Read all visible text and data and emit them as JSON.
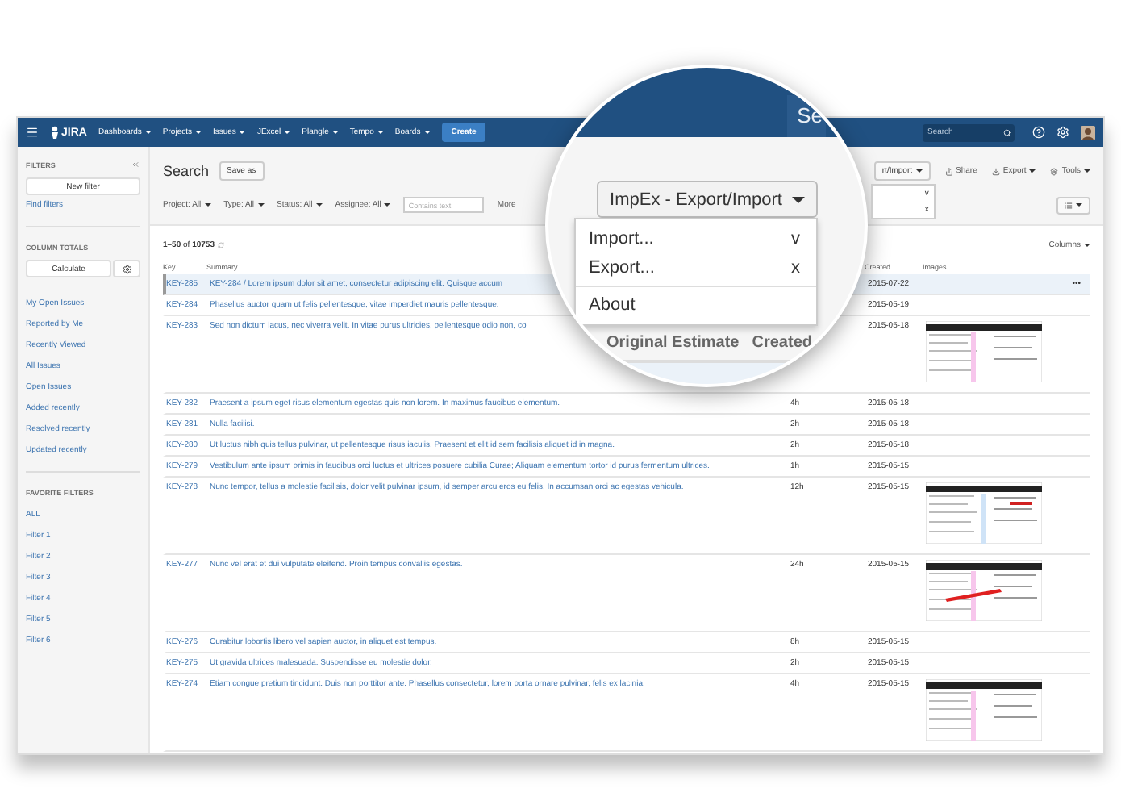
{
  "nav": {
    "logo": "JIRA",
    "items": [
      "Dashboards",
      "Projects",
      "Issues",
      "JExcel",
      "Plangle",
      "Tempo",
      "Boards"
    ],
    "create": "Create",
    "search": {
      "placeholder": "Search"
    }
  },
  "sidebar": {
    "filters_title": "FILTERS",
    "new_filter": "New filter",
    "find_filters": "Find filters",
    "totals_title": "COLUMN TOTALS",
    "calculate": "Calculate",
    "links": [
      "My Open Issues",
      "Reported by Me",
      "Recently Viewed",
      "All Issues",
      "Open Issues",
      "Added recently",
      "Resolved recently",
      "Updated recently"
    ],
    "favorites_title": "FAVORITE FILTERS",
    "favorites": [
      "ALL",
      "Filter 1",
      "Filter 2",
      "Filter 3",
      "Filter 4",
      "Filter 5",
      "Filter 6"
    ]
  },
  "header": {
    "title": "Search",
    "save_as": "Save as",
    "impex_button": "rt/Import",
    "impex_shortcuts": [
      "v",
      "x"
    ],
    "share": "Share",
    "export": "Export",
    "tools": "Tools"
  },
  "filters": [
    "Project: All",
    "Type: All",
    "Status: All",
    "Assignee: All"
  ],
  "contains_text": {
    "placeholder": "Contains text"
  },
  "more": "More",
  "count": "**1–50** of **10753**",
  "columns_button": "Columns",
  "table": {
    "columns": [
      "Key",
      "Summary",
      "Created",
      "Images"
    ],
    "rows": [
      {
        "key": "KEY-285",
        "summary": "KEY-284 / Lorem ipsum dolor sit amet, consectetur adipiscing elit. Quisque accum",
        "created": "2015-07-22",
        "actions": "•••",
        "selected": true
      },
      {
        "key": "KEY-284",
        "summary": "Phasellus auctor quam ut felis pellentesque, vitae imperdiet mauris pellentesque.",
        "created": "2015-05-19",
        "selected": false
      },
      {
        "key": "KEY-283",
        "summary": "Sed non dictum lacus, nec viverra velit. In vitae purus ultricies, pellentesque odio non, co",
        "created": "2015-05-18",
        "selected": false
      },
      {
        "key": "KEY-282",
        "summary": "Praesent a ipsum eget risus elementum egestas quis non lorem. In maximus faucibus elementum.",
        "estimate": "4h",
        "created": "2015-05-18",
        "selected": false
      },
      {
        "key": "KEY-281",
        "summary": "Nulla facilisi.",
        "estimate": "2h",
        "created": "2015-05-18",
        "selected": false
      },
      {
        "key": "KEY-280",
        "summary": "Ut luctus nibh quis tellus pulvinar, ut pellentesque risus iaculis. Praesent et elit id sem facilisis aliquet id in magna.",
        "estimate": "2h",
        "created": "2015-05-18",
        "selected": false
      },
      {
        "key": "KEY-279",
        "summary": "Vestibulum ante ipsum primis in faucibus orci luctus et ultrices posuere cubilia Curae; Aliquam elementum tortor id purus fermentum ultrices.",
        "estimate": "1h",
        "created": "2015-05-15",
        "selected": false
      },
      {
        "key": "KEY-278",
        "summary": "Nunc tempor, tellus a molestie facilisis, dolor velit pulvinar ipsum, id semper arcu eros eu felis. In accumsan orci ac egestas vehicula.",
        "estimate": "12h",
        "created": "2015-05-15",
        "selected": false
      },
      {
        "key": "KEY-277",
        "summary": "Nunc vel erat et dui vulputate eleifend. Proin tempus convallis egestas.",
        "estimate": "24h",
        "created": "2015-05-15",
        "selected": false
      },
      {
        "key": "KEY-276",
        "summary": "Curabitur lobortis libero vel sapien auctor, in aliquet est tempus.",
        "estimate": "8h",
        "created": "2015-05-15",
        "selected": false
      },
      {
        "key": "KEY-275",
        "summary": "Ut gravida ultrices malesuada. Suspendisse eu molestie dolor.",
        "estimate": "2h",
        "created": "2015-05-15",
        "selected": false
      },
      {
        "key": "KEY-274",
        "summary": "Etiam congue pretium tincidunt. Duis non porttitor ante. Phasellus consectetur, lorem porta ornare pulvinar, felis ex lacinia.",
        "estimate": "4h",
        "created": "2015-05-15",
        "selected": false
      }
    ]
  },
  "magnifier": {
    "tab": "Se",
    "button": "ImpEx - Export/Import",
    "menu_groups": [
      [
        {
          "label": "Import...",
          "shortcut": "v"
        },
        {
          "label": "Export...",
          "shortcut": "x"
        }
      ],
      [
        {
          "label": "About"
        }
      ]
    ],
    "columns": [
      "Original Estimate",
      "Created"
    ]
  }
}
